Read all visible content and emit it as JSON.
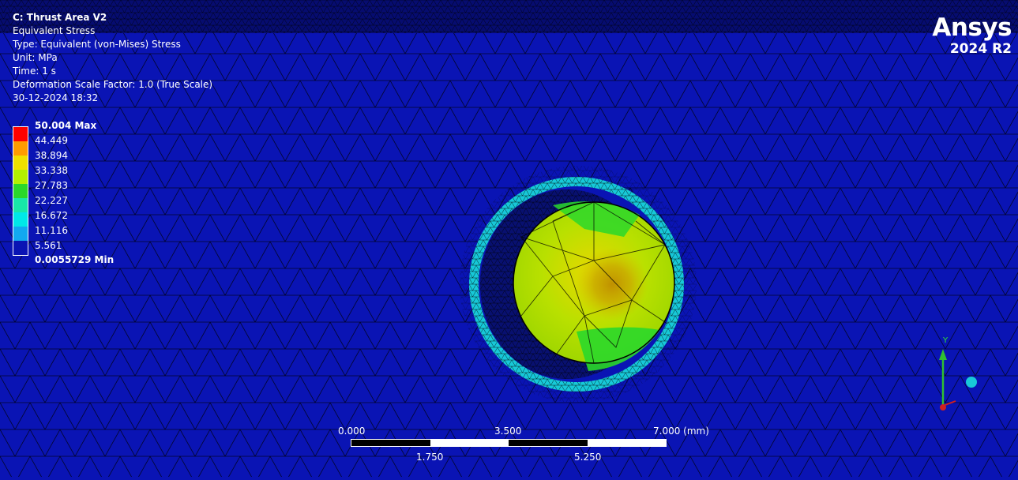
{
  "header": {
    "title": "C: Thrust Area V2",
    "result": "Equivalent Stress",
    "type": "Type: Equivalent (von-Mises) Stress",
    "unit": "Unit: MPa",
    "time": "Time: 1 s",
    "deformation": "Deformation Scale Factor: 1.0 (True Scale)",
    "timestamp": "30-12-2024 18:32"
  },
  "legend": {
    "labels": [
      "50.004 Max",
      "44.449",
      "38.894",
      "33.338",
      "27.783",
      "22.227",
      "16.672",
      "11.116",
      "5.561",
      "0.0055729 Min"
    ],
    "colors": [
      "#ff0000",
      "#ff9c00",
      "#f0e000",
      "#b4f000",
      "#2ad82a",
      "#18e8a8",
      "#00e8e8",
      "#12a8f0",
      "#0a14b4"
    ]
  },
  "logo": {
    "brand": "Ansys",
    "version": "2024 R2"
  },
  "scale_bar": {
    "top_labels": [
      "0.000",
      "3.500",
      "7.000 (mm)"
    ],
    "bottom_labels": [
      "1.750",
      "5.250"
    ]
  },
  "triad": {
    "y_label": "Y"
  }
}
